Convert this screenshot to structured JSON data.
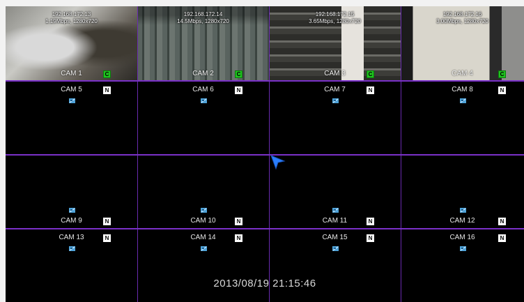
{
  "cameras": [
    {
      "label": "CAM 1",
      "badge": "C",
      "live": true,
      "ip": "192.168.172.13",
      "stream": "1.19Mbps, 1280x720"
    },
    {
      "label": "CAM 2",
      "badge": "C",
      "live": true,
      "ip": "192.168.172.14",
      "stream": "14.5Mbps, 1280x720"
    },
    {
      "label": "CAM 3",
      "badge": "C",
      "live": true,
      "ip": "192.168.172.15",
      "stream": "3.65Mbps, 1280x720"
    },
    {
      "label": "CAM 4",
      "badge": "C",
      "live": true,
      "ip": "192.168.172.16",
      "stream": "3.00Mbps, 1280x720"
    },
    {
      "label": "CAM 5",
      "badge": "N",
      "live": false
    },
    {
      "label": "CAM 6",
      "badge": "N",
      "live": false
    },
    {
      "label": "CAM 7",
      "badge": "N",
      "live": false
    },
    {
      "label": "CAM 8",
      "badge": "N",
      "live": false
    },
    {
      "label": "CAM 9",
      "badge": "N",
      "live": false
    },
    {
      "label": "CAM 10",
      "badge": "N",
      "live": false
    },
    {
      "label": "CAM 11",
      "badge": "N",
      "live": false
    },
    {
      "label": "CAM 12",
      "badge": "N",
      "live": false
    },
    {
      "label": "CAM 13",
      "badge": "N",
      "live": false
    },
    {
      "label": "CAM 14",
      "badge": "N",
      "live": false
    },
    {
      "label": "CAM 15",
      "badge": "N",
      "live": false
    },
    {
      "label": "CAM 16",
      "badge": "N",
      "live": false
    }
  ],
  "icons": {
    "no_signal": "no-video-icon",
    "pointer": "mouse-cursor-icon"
  },
  "colors": {
    "divider": "#7a30c8",
    "badge_connected": "#1fc21f",
    "cursor": "#2a7fff"
  },
  "status": {
    "datetime": "2013/08/19 21:15:46"
  }
}
